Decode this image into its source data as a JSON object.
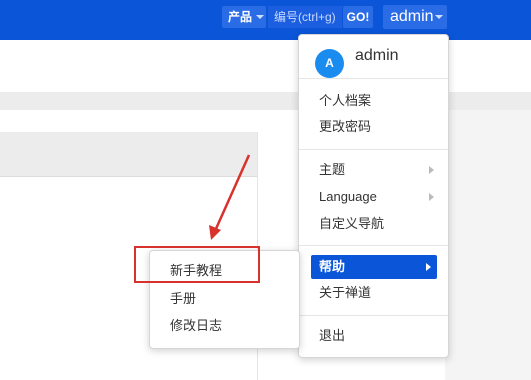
{
  "topbar": {
    "product_label": "产品",
    "search_placeholder": "编号(ctrl+g)",
    "go_label": "GO!",
    "user_label": "admin"
  },
  "user_menu": {
    "avatar_letter": "A",
    "username": "admin",
    "items": [
      {
        "label": "个人档案"
      },
      {
        "label": "更改密码"
      },
      {
        "label": "主题"
      },
      {
        "label": "Language"
      },
      {
        "label": "自定义导航"
      },
      {
        "label": "帮助"
      },
      {
        "label": "关于禅道"
      },
      {
        "label": "退出"
      }
    ]
  },
  "help_menu": {
    "items": [
      {
        "label": "新手教程"
      },
      {
        "label": "手册"
      },
      {
        "label": "修改日志"
      }
    ]
  },
  "colors": {
    "topbar": "#0b55d9",
    "active_item": "#0b55d9",
    "annotation_red": "#d8322c"
  }
}
